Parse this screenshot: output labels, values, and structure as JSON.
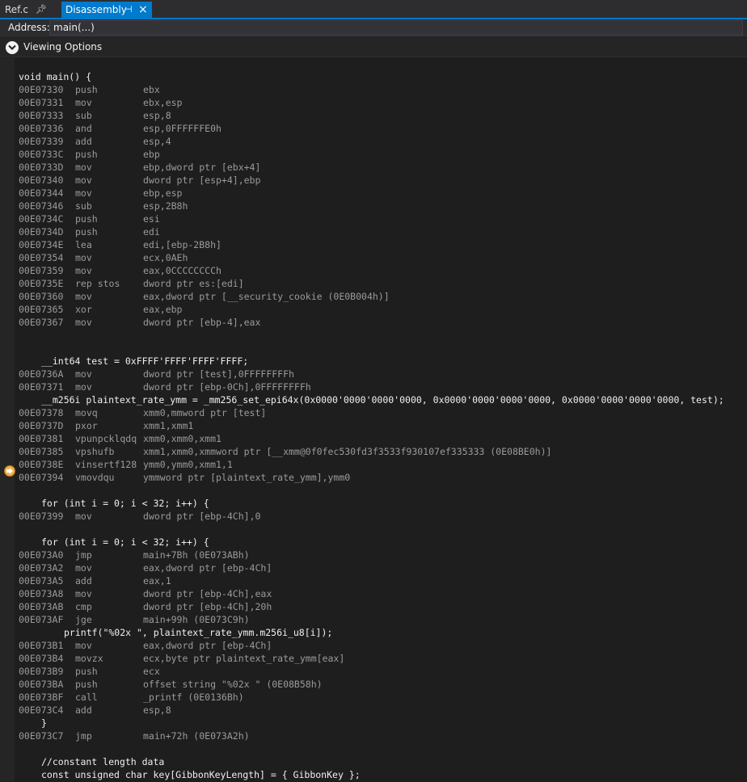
{
  "tabs": [
    {
      "label": "Ref.c",
      "pin": "pin-icon"
    },
    {
      "label": "Disassembly",
      "pin": "pin-icon",
      "close": "×",
      "active": true
    }
  ],
  "address": {
    "label": "Address:",
    "value": "main(...)"
  },
  "viewing_options": {
    "label": "Viewing Options"
  },
  "colors": {
    "accent": "#007acc",
    "marker": "#f0b04a",
    "background": "#1e1e1e"
  },
  "code": [
    {
      "src": "void main() {",
      "indent": 0
    },
    {
      "addr": "00E07330",
      "mn": "push",
      "op": "ebx"
    },
    {
      "addr": "00E07331",
      "mn": "mov",
      "op": "ebx,esp"
    },
    {
      "addr": "00E07333",
      "mn": "sub",
      "op": "esp,8"
    },
    {
      "addr": "00E07336",
      "mn": "and",
      "op": "esp,0FFFFFFE0h"
    },
    {
      "addr": "00E07339",
      "mn": "add",
      "op": "esp,4"
    },
    {
      "addr": "00E0733C",
      "mn": "push",
      "op": "ebp"
    },
    {
      "addr": "00E0733D",
      "mn": "mov",
      "op": "ebp,dword ptr [ebx+4]"
    },
    {
      "addr": "00E07340",
      "mn": "mov",
      "op": "dword ptr [esp+4],ebp"
    },
    {
      "addr": "00E07344",
      "mn": "mov",
      "op": "ebp,esp"
    },
    {
      "addr": "00E07346",
      "mn": "sub",
      "op": "esp,2B8h"
    },
    {
      "addr": "00E0734C",
      "mn": "push",
      "op": "esi"
    },
    {
      "addr": "00E0734D",
      "mn": "push",
      "op": "edi"
    },
    {
      "addr": "00E0734E",
      "mn": "lea",
      "op": "edi,[ebp-2B8h]"
    },
    {
      "addr": "00E07354",
      "mn": "mov",
      "op": "ecx,0AEh"
    },
    {
      "addr": "00E07359",
      "mn": "mov",
      "op": "eax,0CCCCCCCCh"
    },
    {
      "addr": "00E0735E",
      "mn": "rep stos",
      "op": "dword ptr es:[edi]"
    },
    {
      "addr": "00E07360",
      "mn": "mov",
      "op": "eax,dword ptr [__security_cookie (0E0B004h)]"
    },
    {
      "addr": "00E07365",
      "mn": "xor",
      "op": "eax,ebp"
    },
    {
      "addr": "00E07367",
      "mn": "mov",
      "op": "dword ptr [ebp-4],eax"
    },
    {
      "blank": true
    },
    {
      "blank": true
    },
    {
      "src": "__int64 test = 0xFFFF'FFFF'FFFF'FFFF;",
      "indent": 1
    },
    {
      "addr": "00E0736A",
      "mn": "mov",
      "op": "dword ptr [test],0FFFFFFFFh"
    },
    {
      "addr": "00E07371",
      "mn": "mov",
      "op": "dword ptr [ebp-0Ch],0FFFFFFFFh"
    },
    {
      "src": "__m256i plaintext_rate_ymm = _mm256_set_epi64x(0x0000'0000'0000'0000, 0x0000'0000'0000'0000, 0x0000'0000'0000'0000, test);",
      "indent": 1
    },
    {
      "addr": "00E07378",
      "mn": "movq",
      "op": "xmm0,mmword ptr [test]",
      "current": true
    },
    {
      "addr": "00E0737D",
      "mn": "pxor",
      "op": "xmm1,xmm1"
    },
    {
      "addr": "00E07381",
      "mn": "vpunpcklqdq",
      "op": "xmm0,xmm0,xmm1"
    },
    {
      "addr": "00E07385",
      "mn": "vpshufb",
      "op": "xmm1,xmm0,xmmword ptr [__xmm@0f0fec530fd3f3533f930107ef335333 (0E08BE0h)]"
    },
    {
      "addr": "00E0738E",
      "mn": "vinsertf128",
      "op": "ymm0,ymm0,xmm1,1"
    },
    {
      "addr": "00E07394",
      "mn": "vmovdqu",
      "op": "ymmword ptr [plaintext_rate_ymm],ymm0"
    },
    {
      "blank": true
    },
    {
      "src": "for (int i = 0; i < 32; i++) {",
      "indent": 1
    },
    {
      "addr": "00E07399",
      "mn": "mov",
      "op": "dword ptr [ebp-4Ch],0"
    },
    {
      "blank": true
    },
    {
      "src": "for (int i = 0; i < 32; i++) {",
      "indent": 1
    },
    {
      "addr": "00E073A0",
      "mn": "jmp",
      "op": "main+7Bh (0E073ABh)"
    },
    {
      "addr": "00E073A2",
      "mn": "mov",
      "op": "eax,dword ptr [ebp-4Ch]"
    },
    {
      "addr": "00E073A5",
      "mn": "add",
      "op": "eax,1"
    },
    {
      "addr": "00E073A8",
      "mn": "mov",
      "op": "dword ptr [ebp-4Ch],eax"
    },
    {
      "addr": "00E073AB",
      "mn": "cmp",
      "op": "dword ptr [ebp-4Ch],20h"
    },
    {
      "addr": "00E073AF",
      "mn": "jge",
      "op": "main+99h (0E073C9h)"
    },
    {
      "src": "printf(\"%02x \", plaintext_rate_ymm.m256i_u8[i]);",
      "indent": 2
    },
    {
      "addr": "00E073B1",
      "mn": "mov",
      "op": "eax,dword ptr [ebp-4Ch]"
    },
    {
      "addr": "00E073B4",
      "mn": "movzx",
      "op": "ecx,byte ptr plaintext_rate_ymm[eax]"
    },
    {
      "addr": "00E073B9",
      "mn": "push",
      "op": "ecx"
    },
    {
      "addr": "00E073BA",
      "mn": "push",
      "op": "offset string \"%02x \" (0E08B58h)"
    },
    {
      "addr": "00E073BF",
      "mn": "call",
      "op": "_printf (0E0136Bh)"
    },
    {
      "addr": "00E073C4",
      "mn": "add",
      "op": "esp,8"
    },
    {
      "src": "}",
      "indent": 1
    },
    {
      "addr": "00E073C7",
      "mn": "jmp",
      "op": "main+72h (0E073A2h)"
    },
    {
      "blank": true
    },
    {
      "src": "//constant length data",
      "indent": 1
    },
    {
      "src": "const unsigned char key[GibbonKeyLength] = { GibbonKey };",
      "indent": 1
    }
  ]
}
